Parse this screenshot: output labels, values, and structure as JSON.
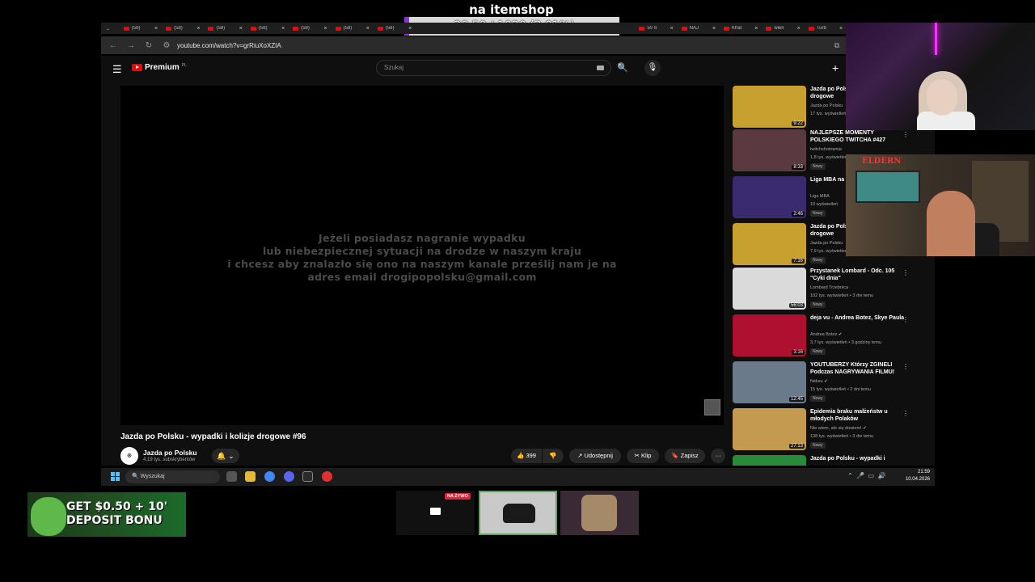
{
  "overlay": {
    "title": "na itemshop",
    "progress_text": "20.50 / 1020 (2.01%)",
    "progress_fraction": 0.0201
  },
  "browser": {
    "tabs": [
      "(58)",
      "(58)",
      "(58)",
      "(58)",
      "(58)",
      "(58)",
      "(58)"
    ],
    "right_tabs": [
      "50 S",
      "NAJ",
      "Khal",
      "wieli",
      "Turb"
    ],
    "url": "youtube.com/watch?v=grRiuXoXZIA"
  },
  "youtube": {
    "logo_text": "Premium",
    "logo_region": "PL",
    "search_placeholder": "Szukaj",
    "player_message": [
      "Jeżeli posiadasz nagranie wypadku",
      "lub niebezpiecznej sytuacji na drodze w naszym kraju",
      "i chcesz aby znalazło się ono na naszym kanale prześlij nam je na",
      "adres email drogipopolsku@gmail.com"
    ],
    "video_title": "Jazda po Polsku - wypadki i kolizje drogowe #96",
    "channel_name": "Jazda po Polsku",
    "channel_subs": "4,19 tys. subskrybentów",
    "likes": "399",
    "share_label": "Udostępnij",
    "clip_label": "Klip",
    "save_label": "Zapisz"
  },
  "recommendations": [
    {
      "title": "Jazda po Polsku - wypadki i kolizje drogowe",
      "channel": "Jazda po Polsku",
      "views": "17 tys. wyświetleń",
      "duration": "9:22",
      "new": ""
    },
    {
      "title": "NAJLEPSZE MOMENTY POLSKIEGO TWITCHA #427",
      "channel": "twitchshotownia",
      "views": "1,8 tys. wyświetleń",
      "duration": "8:33",
      "new": "Nowy"
    },
    {
      "title": "Liga MBA na kosza",
      "channel": "Liga MBA",
      "views": "10 wyświetleń",
      "duration": "2:46",
      "new": "Nowy"
    },
    {
      "title": "Jazda po Polsku - wypadki i kolizje drogowe",
      "channel": "Jazda po Polsku",
      "views": "7,9 tys. wyświetleń",
      "duration": "7:16",
      "new": "Nowy"
    },
    {
      "title": "Przystanek Lombard - Odc. 105 \"Cyki dnia\"",
      "channel": "Lombard Trzebnica",
      "views": "102 tys. wyświetleń • 3 dni temu",
      "duration": "56:03",
      "new": "Nowy"
    },
    {
      "title": "deja vu - Andrea Botez, Skye Paula",
      "channel": "Andrea Botez ✔",
      "views": "3,7 tys. wyświetleń • 3 godziny temu",
      "duration": "3:16",
      "new": "Nowy"
    },
    {
      "title": "YOUTUBERZY Którzy ZGINELI Podczas NAGRYWANIA FILMU!",
      "channel": "Neksu ✔",
      "views": "15 tys. wyświetleń • 2 dni temu",
      "duration": "12:45",
      "new": "Nowy"
    },
    {
      "title": "Epidemia braku małżeństw u młodych Polaków",
      "channel": "Nie wiem, ale się dowiem! ✔",
      "views": "138 tys. wyświetleń • 3 dni temu",
      "duration": "27:13",
      "new": "Nowy"
    },
    {
      "title": "Jazda po Polsku - wypadki i",
      "channel": "",
      "views": "",
      "duration": "",
      "new": ""
    }
  ],
  "thumb_colors": [
    "#c8a030",
    "#5a3a40",
    "#3a2a70",
    "#c8a030",
    "#dadada",
    "#b01030",
    "#6a7a8a",
    "#c49a50",
    "#2a8a3a"
  ],
  "webcam2_badge": "ELDERN",
  "taskbar": {
    "search_placeholder": "Wyszukaj",
    "time": "21:59",
    "date": "10.04.2026"
  },
  "ad": {
    "text": "GET $0.50 + 10' DEPOSIT BONU"
  },
  "scenes": {
    "live_label": "NA ŻYWO"
  }
}
